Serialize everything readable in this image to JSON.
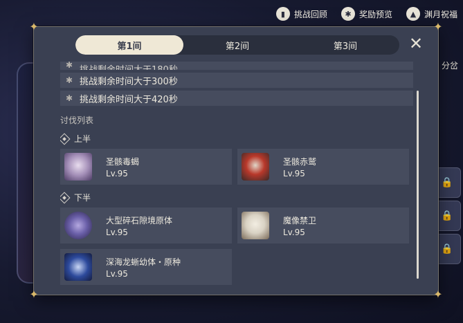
{
  "top_bar": [
    {
      "label": "挑战回顾",
      "icon": "book-icon"
    },
    {
      "label": "奖励预览",
      "icon": "gear-star-icon"
    },
    {
      "label": "渊月祝福",
      "icon": "moon-icon"
    }
  ],
  "background": {
    "side_label": "分岔"
  },
  "tabs": [
    {
      "label": "第1间",
      "active": true
    },
    {
      "label": "第2间",
      "active": false
    },
    {
      "label": "第3间",
      "active": false
    }
  ],
  "conditions": [
    {
      "text": "挑战剩余时间大于180秒",
      "partial": true
    },
    {
      "text": "挑战剩余时间大于300秒",
      "partial": false
    },
    {
      "text": "挑战剩余时间大于420秒",
      "partial": false
    }
  ],
  "enemy_section": {
    "title": "讨伐列表",
    "halves": [
      {
        "label": "上半",
        "enemies": [
          {
            "name": "圣骸毒蝎",
            "level": "Lv.95",
            "portrait_color": "#c9b8d8"
          },
          {
            "name": "圣骸赤鹫",
            "level": "Lv.95",
            "portrait_color": "#b8382a"
          }
        ]
      },
      {
        "label": "下半",
        "enemies": [
          {
            "name": "大型碎石隙境原体",
            "level": "Lv.95",
            "portrait_color": "#6a5fa8"
          },
          {
            "name": "魔像禁卫",
            "level": "Lv.95",
            "portrait_color": "#d9d2c4"
          },
          {
            "name": "深海龙蜥幼体・原种",
            "level": "Lv.95",
            "portrait_color": "#2d4a9c"
          }
        ]
      }
    ]
  },
  "colors": {
    "modal_bg": "#3a4052",
    "row_bg": "#464c5e",
    "tab_active": "#efe8d6",
    "accent_gold": "#d9b86a"
  }
}
